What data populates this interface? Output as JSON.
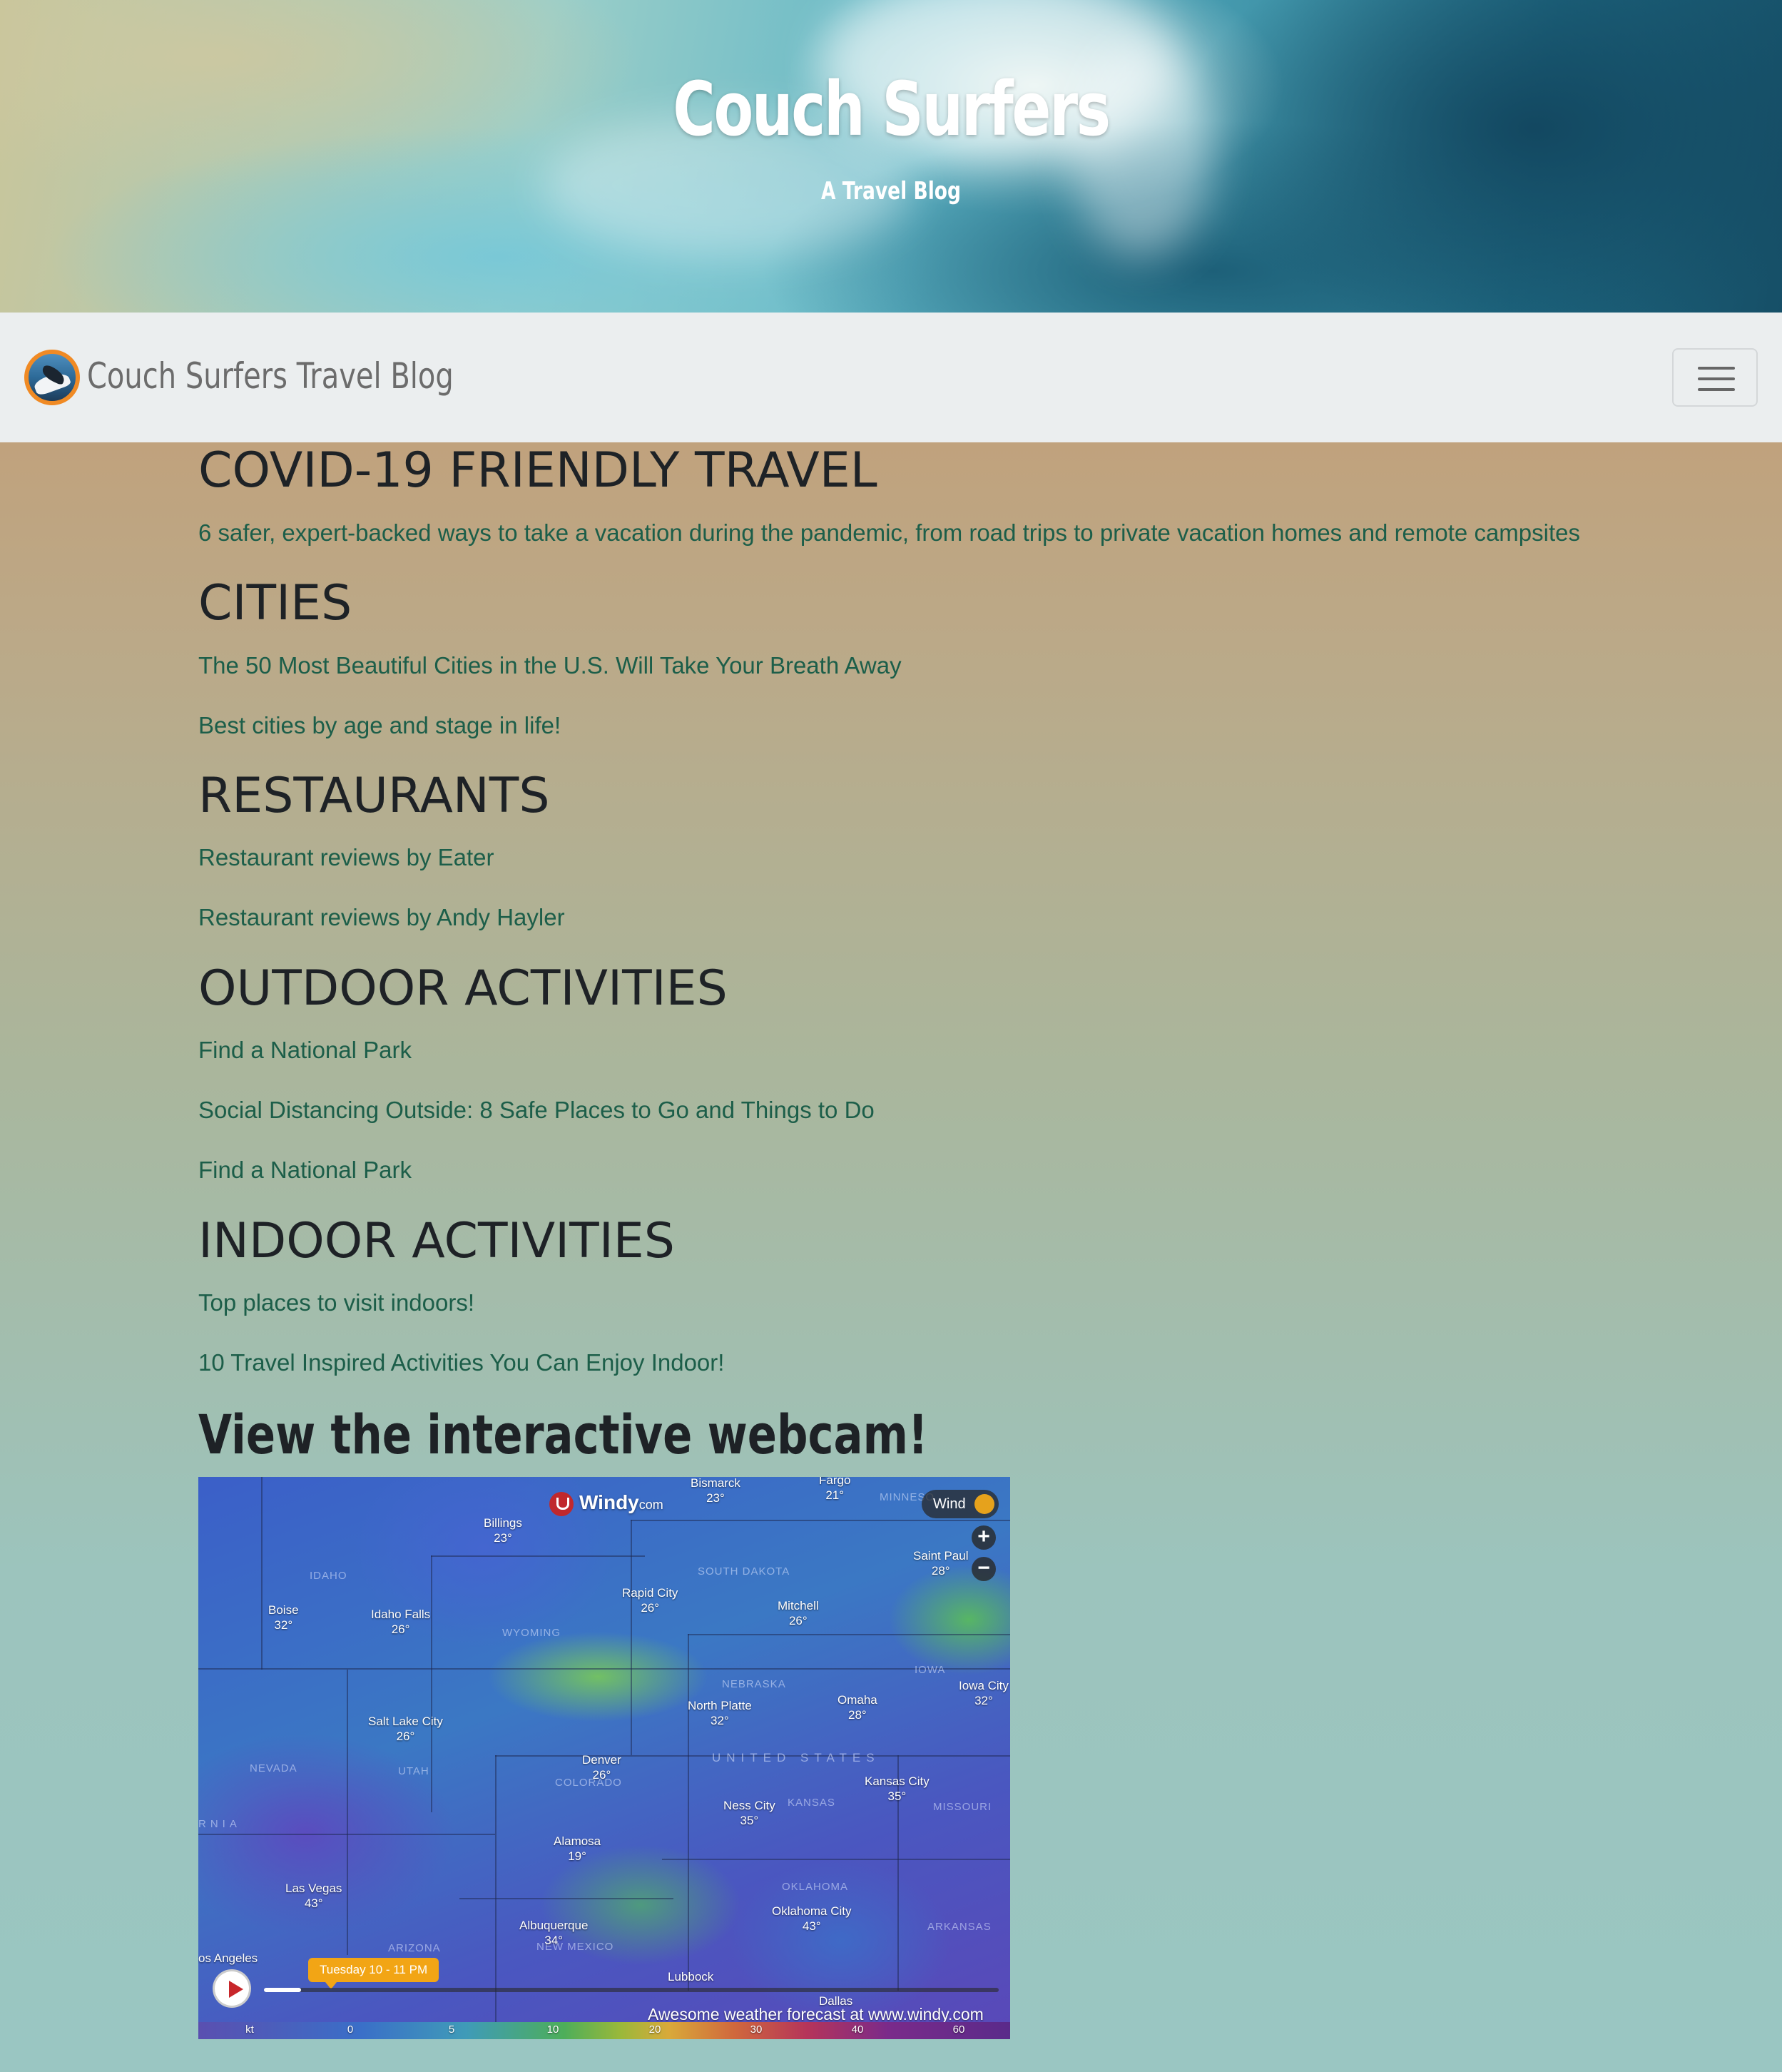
{
  "hero": {
    "title": "Couch Surfers",
    "subtitle": "A Travel Blog"
  },
  "navbar": {
    "brand": "Couch Surfers Travel Blog",
    "toggler_icon": "hamburger-menu-icon"
  },
  "sections": [
    {
      "title": "COVID-19 FRIENDLY TRAVEL",
      "links": [
        "6 safer, expert-backed ways to take a vacation during the pandemic, from road trips to private vacation homes and remote campsites"
      ]
    },
    {
      "title": "CITIES",
      "links": [
        "The 50 Most Beautiful Cities in the U.S. Will Take Your Breath Away",
        "Best cities by age and stage in life!"
      ]
    },
    {
      "title": "RESTAURANTS",
      "links": [
        "Restaurant reviews by Eater",
        "Restaurant reviews by Andy Hayler"
      ]
    },
    {
      "title": "OUTDOOR ACTIVITIES",
      "links": [
        "Find a National Park",
        "Social Distancing Outside: 8 Safe Places to Go and Things to Do",
        "Find a National Park"
      ]
    },
    {
      "title": "INDOOR ACTIVITIES",
      "links": [
        "Top places to visit indoors!",
        "10 Travel Inspired Activities You Can Enjoy Indoor!"
      ]
    }
  ],
  "webcam": {
    "title": "View the interactive webcam!"
  },
  "map": {
    "logo_text": "Windy",
    "logo_suffix": "com",
    "layer_label": "Wind",
    "zoom_in": "+",
    "zoom_out": "−",
    "time_label": "Tuesday 10 - 11 PM",
    "timeline_progress": 0.05,
    "footer_text": "Awesome weather forecast at www.windy.com",
    "scale_unit": "kt",
    "scale_ticks": [
      "0",
      "5",
      "10",
      "20",
      "30",
      "40",
      "60"
    ],
    "regions": [
      "MINNESO",
      "SOUTH DAKOTA",
      "IDAHO",
      "WYOMING",
      "NEBRASKA",
      "IOWA",
      "UNITED STATES",
      "NEVADA",
      "UTAH",
      "COLORADO",
      "KANSAS",
      "MISSOURI",
      "RNIA",
      "OKLAHOMA",
      "ARKANSAS",
      "ARIZONA",
      "NEW MEXICO"
    ],
    "cities": [
      {
        "name": "Bismarck",
        "temp": "23°"
      },
      {
        "name": "Fargo",
        "temp": "21°"
      },
      {
        "name": "Billings",
        "temp": "23°"
      },
      {
        "name": "Saint Paul",
        "temp": "28°"
      },
      {
        "name": "Boise",
        "temp": "32°"
      },
      {
        "name": "Idaho Falls",
        "temp": "26°"
      },
      {
        "name": "Rapid City",
        "temp": "26°"
      },
      {
        "name": "Mitchell",
        "temp": "26°"
      },
      {
        "name": "Iowa City",
        "temp": "32°"
      },
      {
        "name": "Omaha",
        "temp": "28°"
      },
      {
        "name": "North Platte",
        "temp": "32°"
      },
      {
        "name": "Salt Lake City",
        "temp": "26°"
      },
      {
        "name": "Denver",
        "temp": "26°"
      },
      {
        "name": "Kansas City",
        "temp": "35°"
      },
      {
        "name": "Ness City",
        "temp": "35°"
      },
      {
        "name": "Alamosa",
        "temp": "19°"
      },
      {
        "name": "Las Vegas",
        "temp": "43°"
      },
      {
        "name": "Oklahoma City",
        "temp": "43°"
      },
      {
        "name": "Albuquerque",
        "temp": "34°"
      },
      {
        "name": "os Angeles",
        "temp": ""
      },
      {
        "name": "Lubbock",
        "temp": ""
      },
      {
        "name": "Dallas",
        "temp": ""
      }
    ]
  }
}
